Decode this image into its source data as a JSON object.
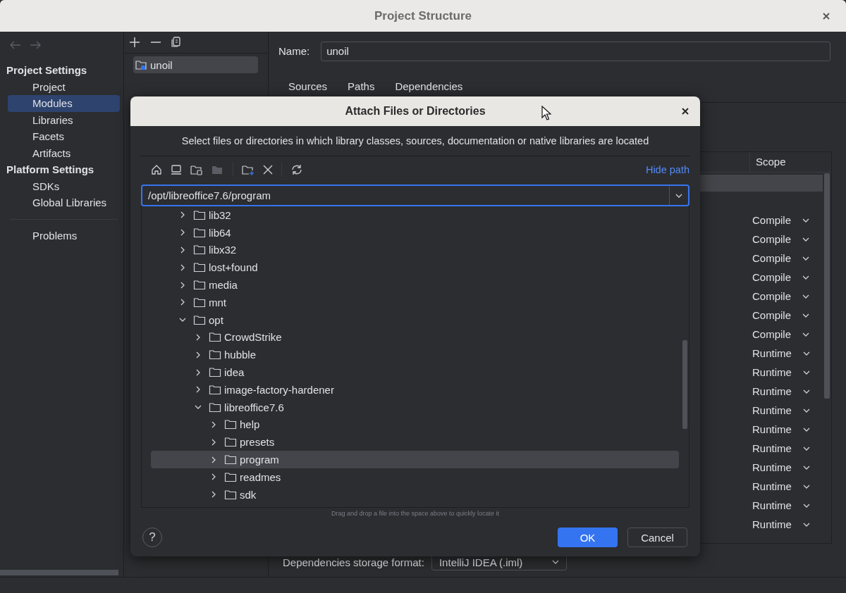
{
  "window": {
    "title": "Project Structure"
  },
  "sidebar": {
    "sections": [
      {
        "heading": "Project Settings",
        "items": [
          {
            "label": "Project",
            "selected": false
          },
          {
            "label": "Modules",
            "selected": true
          },
          {
            "label": "Libraries",
            "selected": false
          },
          {
            "label": "Facets",
            "selected": false
          },
          {
            "label": "Artifacts",
            "selected": false
          }
        ]
      },
      {
        "heading": "Platform Settings",
        "items": [
          {
            "label": "SDKs",
            "selected": false
          },
          {
            "label": "Global Libraries",
            "selected": false
          }
        ]
      }
    ],
    "extra_items": [
      {
        "label": "Problems",
        "selected": false
      }
    ]
  },
  "modules": {
    "items": [
      {
        "label": "unoil",
        "selected": true
      }
    ]
  },
  "module_panel": {
    "name_label": "Name:",
    "name_value": "unoil",
    "tabs": [
      {
        "label": "Sources"
      },
      {
        "label": "Paths"
      },
      {
        "label": "Dependencies"
      }
    ],
    "dependencies": {
      "scope_header": "Scope",
      "rows": [
        {
          "selected": true
        },
        {
          "selected": false
        },
        {
          "scope": "Compile",
          "selected": false
        },
        {
          "scope": "Compile",
          "selected": false
        },
        {
          "scope": "Compile",
          "selected": false
        },
        {
          "scope": "Compile",
          "selected": false
        },
        {
          "scope": "Compile",
          "selected": false
        },
        {
          "scope": "Compile",
          "selected": false
        },
        {
          "scope": "Compile",
          "selected": false
        },
        {
          "scope": "Runtime",
          "selected": false
        },
        {
          "scope": "Runtime",
          "selected": false
        },
        {
          "scope": "Runtime",
          "selected": false
        },
        {
          "scope": "Runtime",
          "selected": false
        },
        {
          "scope": "Runtime",
          "selected": false
        },
        {
          "scope": "Runtime",
          "selected": false
        },
        {
          "scope": "Runtime",
          "selected": false
        },
        {
          "scope": "Runtime",
          "selected": false
        },
        {
          "scope": "Runtime",
          "selected": false
        },
        {
          "scope": "Runtime",
          "selected": false
        }
      ]
    },
    "storage_format": {
      "label": "Dependencies storage format:",
      "value": "IntelliJ IDEA (.iml)"
    }
  },
  "dialog": {
    "title": "Attach Files or Directories",
    "description": "Select files or directories in which library classes, sources, documentation or native libraries are located",
    "hide_path": "Hide path",
    "path": "/opt/libreoffice7.6/program",
    "tree": [
      {
        "label": "lib32",
        "expanded": false,
        "selected": false
      },
      {
        "label": "lib64",
        "expanded": false,
        "selected": false
      },
      {
        "label": "libx32",
        "expanded": false,
        "selected": false
      },
      {
        "label": "lost+found",
        "expanded": false,
        "selected": false
      },
      {
        "label": "media",
        "expanded": false,
        "selected": false
      },
      {
        "label": "mnt",
        "expanded": false,
        "selected": false
      },
      {
        "label": "opt",
        "expanded": true,
        "selected": false,
        "children": [
          {
            "label": "CrowdStrike",
            "expanded": false,
            "selected": false
          },
          {
            "label": "hubble",
            "expanded": false,
            "selected": false
          },
          {
            "label": "idea",
            "expanded": false,
            "selected": false
          },
          {
            "label": "image-factory-hardener",
            "expanded": false,
            "selected": false
          },
          {
            "label": "libreoffice7.6",
            "expanded": true,
            "selected": false,
            "children": [
              {
                "label": "help",
                "expanded": false,
                "selected": false
              },
              {
                "label": "presets",
                "expanded": false,
                "selected": false
              },
              {
                "label": "program",
                "expanded": false,
                "selected": true
              },
              {
                "label": "readmes",
                "expanded": false,
                "selected": false
              },
              {
                "label": "sdk",
                "expanded": false,
                "selected": false
              }
            ]
          }
        ]
      }
    ],
    "help": "?",
    "hint": "Drag and drop a file into the space above to quickly locate it",
    "buttons": [
      {
        "label": "OK",
        "kind": "primary"
      },
      {
        "label": "Cancel",
        "kind": "secondary"
      }
    ]
  }
}
